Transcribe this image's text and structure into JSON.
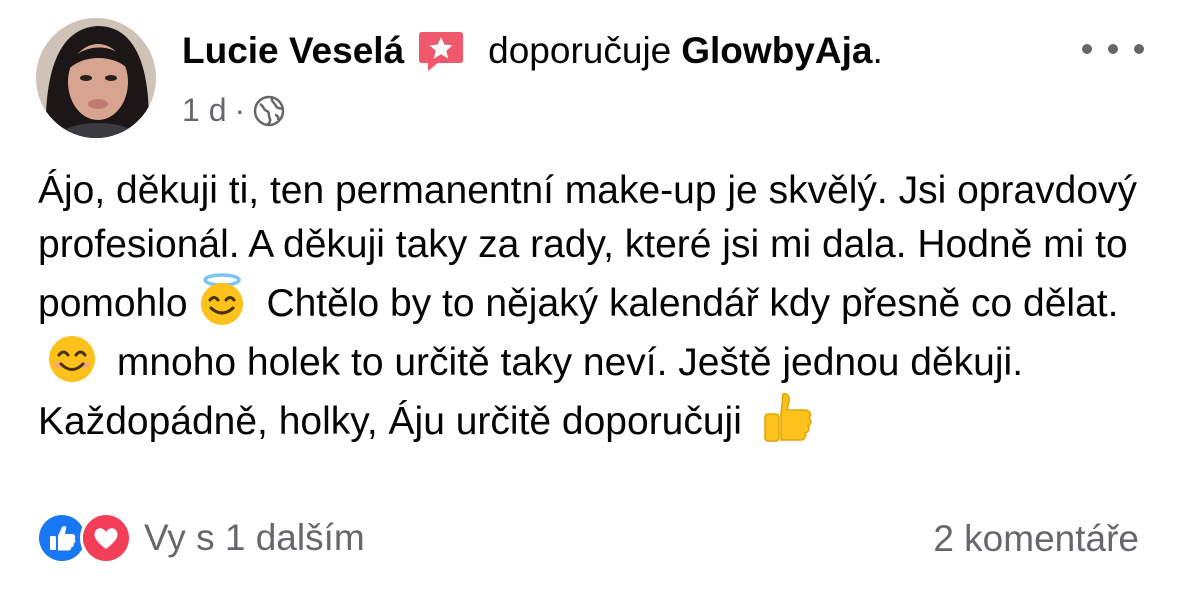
{
  "post": {
    "author": "Lucie Veselá",
    "verb": "doporučuje",
    "page_name": "GlowbyAja",
    "page_suffix": ".",
    "time": "1 d",
    "meta_separator": "·",
    "audience_icon": "globe-icon",
    "recommend_icon": "recommendation-star-icon",
    "more_icon": "more-options-icon",
    "text_parts": [
      "Ájo, děkuji ti, ten permanentní make-up je skvělý. Jsi opravdový profesionál. A děkuji taky za rady, které jsi mi dala. Hodně mi to pomohlo",
      "Chtělo by to nějaký kalendář kdy přesně co dělat.",
      "mnoho holek to určitě taky neví. Ještě jednou děkuji. Každopádně, holky, Áju určitě doporučuji"
    ],
    "emojis": [
      "smiling-face-with-halo-icon",
      "smiling-face-icon",
      "thumbs-up-icon"
    ]
  },
  "footer": {
    "reactions_label": "Vy s 1 dalším",
    "reaction_icons": [
      "like-reaction-icon",
      "love-reaction-icon"
    ],
    "comments_label": "2 komentáře"
  },
  "colors": {
    "text": "#050505",
    "secondary": "#65676b",
    "like_blue": "#1877f2",
    "love_red": "#f33e58",
    "recommend_pink": "#f0596d"
  }
}
